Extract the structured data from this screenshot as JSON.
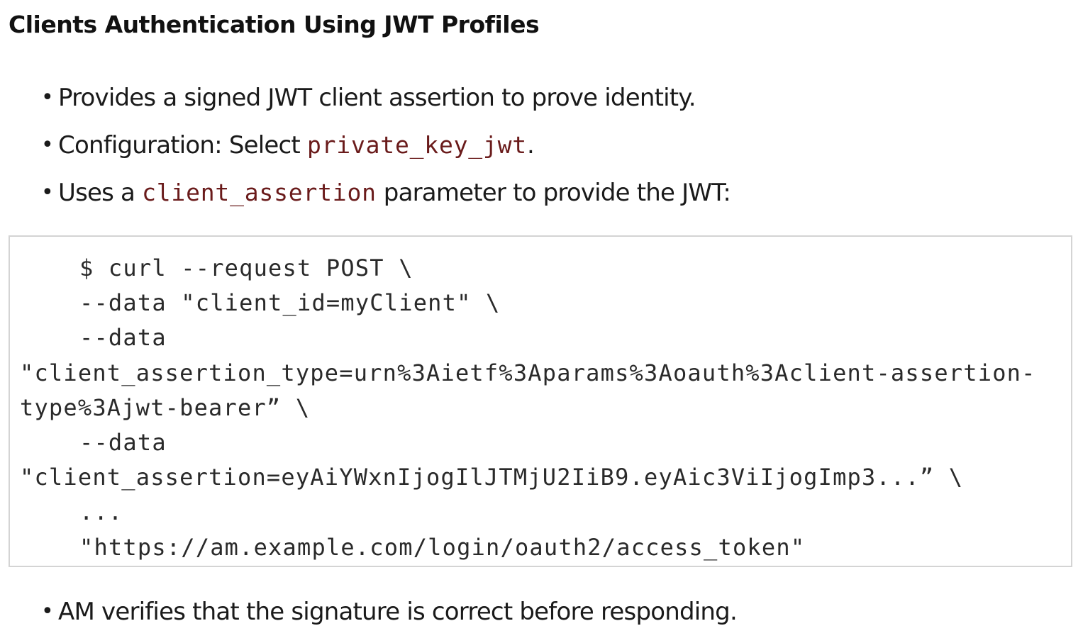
{
  "title": "Clients Authentication Using JWT Profiles",
  "bullets_top": [
    {
      "before": "Provides a signed JWT client assertion to prove identity.",
      "code": "",
      "after": ""
    },
    {
      "before": "Configuration: Select ",
      "code": "private_key_jwt",
      "after": "."
    },
    {
      "before": "Uses a ",
      "code": "client_assertion",
      "after": " parameter to provide the JWT:"
    }
  ],
  "code_lines": [
    "$ curl --request POST \\",
    "--data \"client_id=myClient\" \\",
    "--data",
    "\"client_assertion_type=urn%3Aietf%3Aparams%3Aoauth%3Aclient-assertion-",
    "type%3Ajwt-bearer” \\",
    "--data",
    "\"client_assertion=eyAiYWxnIjogIlJTMjU2IiB9.eyAic3ViIjogImp3...” \\",
    "...",
    "\"https://am.example.com/login/oauth2/access_token\""
  ],
  "bullets_bottom": [
    {
      "before": "AM verifies that the signature is correct before responding.",
      "code": "",
      "after": ""
    }
  ],
  "bullet_symbol": "•"
}
